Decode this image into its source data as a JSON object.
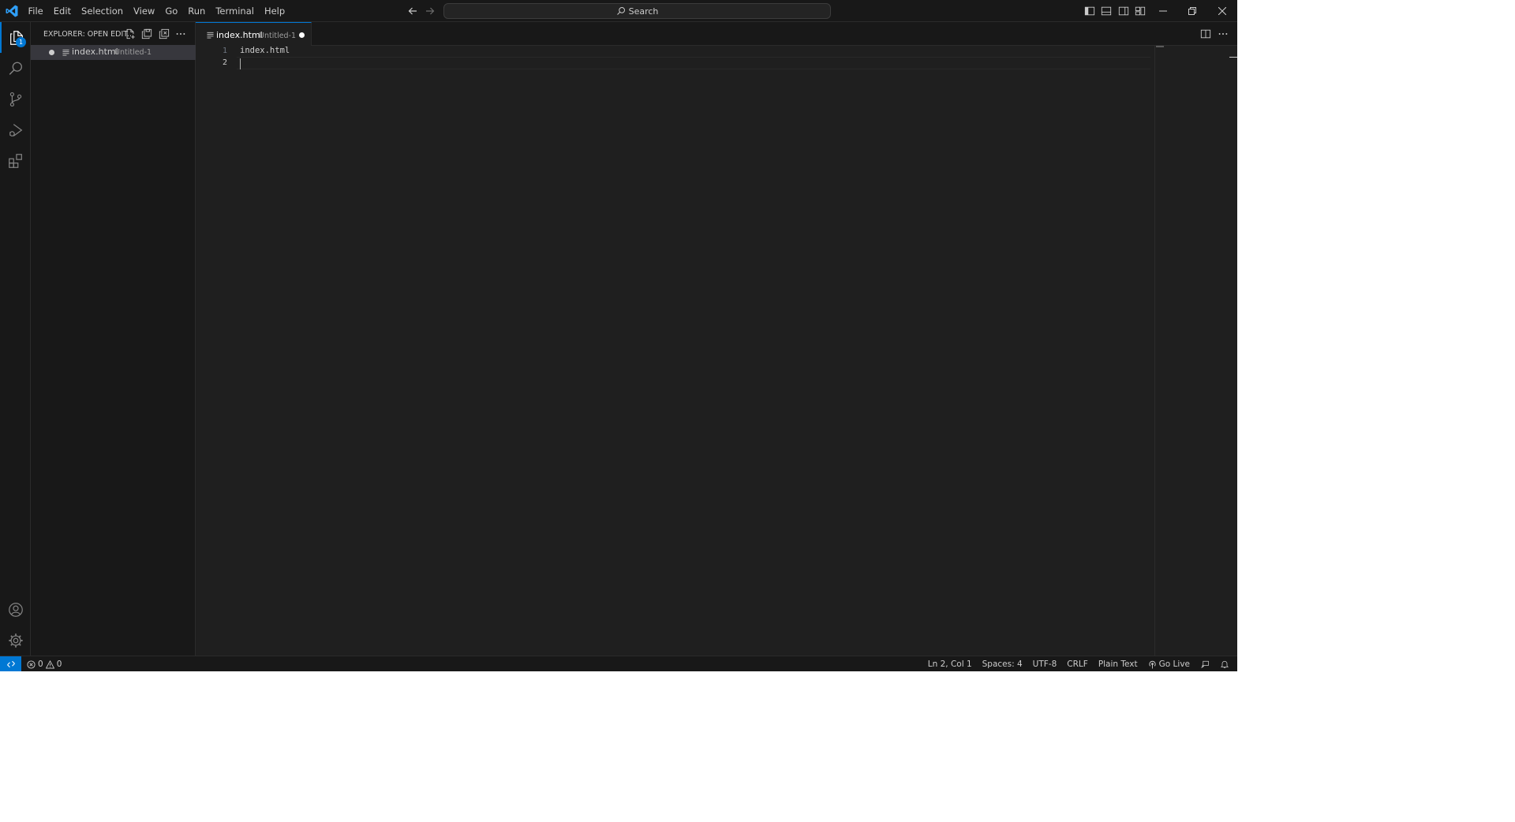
{
  "menu": [
    "File",
    "Edit",
    "Selection",
    "View",
    "Go",
    "Run",
    "Terminal",
    "Help"
  ],
  "command_center": {
    "label": "Search"
  },
  "activity_bar": {
    "explorer_badge": "1"
  },
  "sidebar": {
    "title": "EXPLORER: OPEN EDIT...",
    "open_editor": {
      "name": "index.html",
      "description": "Untitled-1"
    }
  },
  "tab": {
    "name": "index.html",
    "description": "Untitled-1"
  },
  "editor": {
    "lines": [
      {
        "number": "1",
        "text": "index.html"
      },
      {
        "number": "2",
        "text": ""
      }
    ]
  },
  "statusbar": {
    "errors": "0",
    "warnings": "0",
    "position": "Ln 2, Col 1",
    "spaces": "Spaces: 4",
    "encoding": "UTF-8",
    "eol": "CRLF",
    "language": "Plain Text",
    "go_live": "Go Live"
  },
  "colors": {
    "accent": "#0078d4",
    "editor_background": "#1f1f1f",
    "chrome_background": "#181818"
  }
}
